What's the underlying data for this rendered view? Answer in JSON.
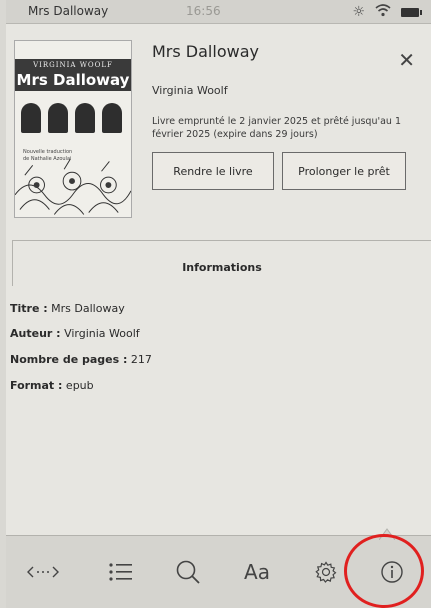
{
  "status_bar": {
    "title": "Mrs Dalloway",
    "time": "16:56",
    "icons": [
      "brightness-icon",
      "wifi-icon",
      "battery-icon"
    ]
  },
  "cover": {
    "author": "VIRGINIA WOOLF",
    "title": "Mrs Dalloway",
    "note_line1": "Nouvelle traduction",
    "note_line2": "de Nathalie Azoulai"
  },
  "book": {
    "title": "Mrs Dalloway",
    "author": "Virginia Woolf",
    "loan_text": "Livre emprunté le 2 janvier 2025 et prêté jusqu'au 1 février 2025 (expire dans 29 jours)"
  },
  "buttons": {
    "return_label": "Rendre le livre",
    "extend_label": "Prolonger le prêt"
  },
  "info": {
    "header": "Informations",
    "rows": [
      {
        "label": "Titre :",
        "value": "Mrs Dalloway"
      },
      {
        "label": "Auteur :",
        "value": "Virginia Woolf"
      },
      {
        "label": "Nombre de pages :",
        "value": "217"
      },
      {
        "label": "Format :",
        "value": "epub"
      }
    ]
  },
  "toolbar": {
    "items": [
      "navigation-icon",
      "toc-icon",
      "search-icon",
      "font-settings-icon",
      "settings-gear-icon",
      "info-icon"
    ],
    "font_label": "Aa"
  },
  "highlight_color": "#e0201f"
}
